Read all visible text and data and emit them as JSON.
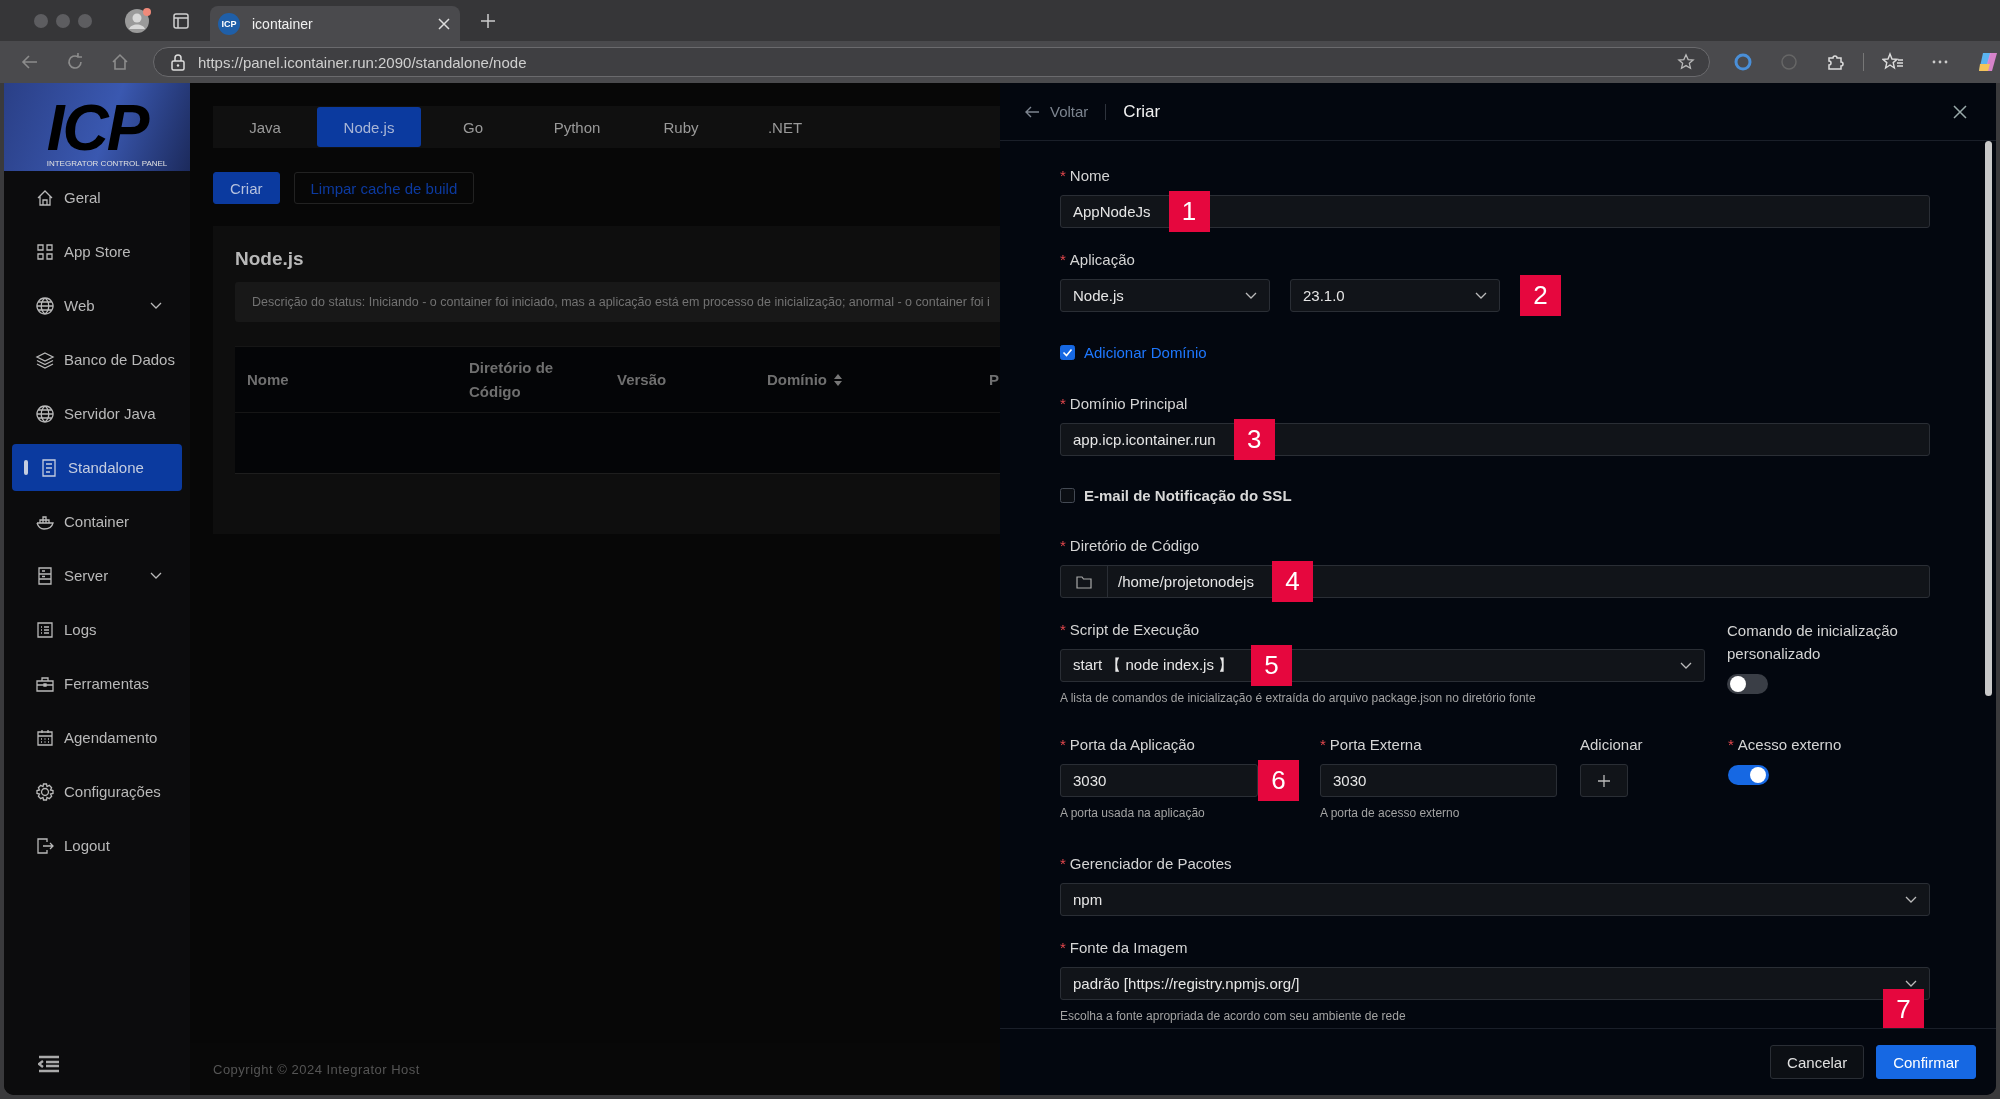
{
  "browser": {
    "tab_title": "icontainer",
    "favicon": "ICP",
    "url": "https://panel.icontainer.run:2090/standalone/node"
  },
  "sidebar": {
    "logo": "ICP",
    "logo_tagline": "INTEGRATOR CONTROL PANEL",
    "items": [
      {
        "label": "Geral",
        "selected": false,
        "has_submenu": false
      },
      {
        "label": "App Store",
        "selected": false,
        "has_submenu": false
      },
      {
        "label": "Web",
        "selected": false,
        "has_submenu": true
      },
      {
        "label": "Banco de Dados",
        "selected": false,
        "has_submenu": false
      },
      {
        "label": "Servidor Java",
        "selected": false,
        "has_submenu": false
      },
      {
        "label": "Standalone",
        "selected": true,
        "has_submenu": false
      },
      {
        "label": "Container",
        "selected": false,
        "has_submenu": false
      },
      {
        "label": "Server",
        "selected": false,
        "has_submenu": true
      },
      {
        "label": "Logs",
        "selected": false,
        "has_submenu": false
      },
      {
        "label": "Ferramentas",
        "selected": false,
        "has_submenu": false
      },
      {
        "label": "Agendamento",
        "selected": false,
        "has_submenu": false
      },
      {
        "label": "Configurações",
        "selected": false,
        "has_submenu": false
      },
      {
        "label": "Logout",
        "selected": false,
        "has_submenu": false
      }
    ]
  },
  "tabs": [
    {
      "label": "Java",
      "selected": false
    },
    {
      "label": "Node.js",
      "selected": true
    },
    {
      "label": "Go",
      "selected": false
    },
    {
      "label": "Python",
      "selected": false
    },
    {
      "label": "Ruby",
      "selected": false
    },
    {
      "label": ".NET",
      "selected": false
    }
  ],
  "actions": [
    {
      "label": "Criar",
      "primary": true
    },
    {
      "label": "Limpar cache de build",
      "primary": false
    }
  ],
  "card": {
    "title": "Node.js",
    "status_note": "Descrição do status: Iniciando - o container foi iniciado, mas a aplicação está em processo de inicialização; anormal - o container foi i",
    "columns": [
      {
        "label": "Nome",
        "sortable": false
      },
      {
        "label": "Diretório de Código",
        "sortable": false
      },
      {
        "label": "Versão",
        "sortable": false
      },
      {
        "label": "Domínio",
        "sortable": true
      },
      {
        "label": "P",
        "sortable": false
      }
    ]
  },
  "footer": "Copyright © 2024 Integrator Host",
  "drawer": {
    "back": "Voltar",
    "title": "Criar",
    "name": {
      "required_mark": "*",
      "label": "Nome",
      "value": "AppNodeJs",
      "marker": "1"
    },
    "application": {
      "required_mark": "*",
      "label": "Aplicação",
      "runtime": "Node.js",
      "version": "23.1.0",
      "marker": "2"
    },
    "add_domain": {
      "label": "Adicionar Domínio",
      "checked": true
    },
    "domain": {
      "required_mark": "*",
      "label": "Domínio Principal",
      "value": "app.icp.icontainer.run",
      "marker": "3"
    },
    "ssl_email": {
      "label": "E-mail de Notificação do SSL",
      "checked": false
    },
    "code_dir": {
      "required_mark": "*",
      "label": "Diretório de Código",
      "value": "/home/projetonodejs",
      "marker": "4"
    },
    "script": {
      "required_mark": "*",
      "label": "Script de Execução",
      "value": "start 【 node index.js 】",
      "hint": "A lista de comandos de inicialização é extraída do arquivo package.json no diretório fonte",
      "marker": "5"
    },
    "custom_command": {
      "label": "Comando de inicialização personalizado",
      "on": false
    },
    "app_port": {
      "required_mark": "*",
      "label": "Porta da Aplicação",
      "value": "3030",
      "hint": "A porta usada na aplicação",
      "marker": "6"
    },
    "external_port": {
      "required_mark": "*",
      "label": "Porta Externa",
      "value": "3030",
      "hint": "A porta de acesso externo"
    },
    "add": {
      "label": "Adicionar"
    },
    "external_access": {
      "required_mark": "*",
      "label": "Acesso externo",
      "on": true
    },
    "package_manager": {
      "required_mark": "*",
      "label": "Gerenciador de Pacotes",
      "value": "npm"
    },
    "image_source": {
      "required_mark": "*",
      "label": "Fonte da Imagem",
      "value": "padrão [https://registry.npmjs.org/]",
      "hint": "Escolha a fonte apropriada de acordo com seu ambiente de rede",
      "marker": "7"
    },
    "buttons": [
      {
        "label": "Cancelar",
        "primary": false
      },
      {
        "label": "Confirmar",
        "primary": true
      }
    ]
  }
}
